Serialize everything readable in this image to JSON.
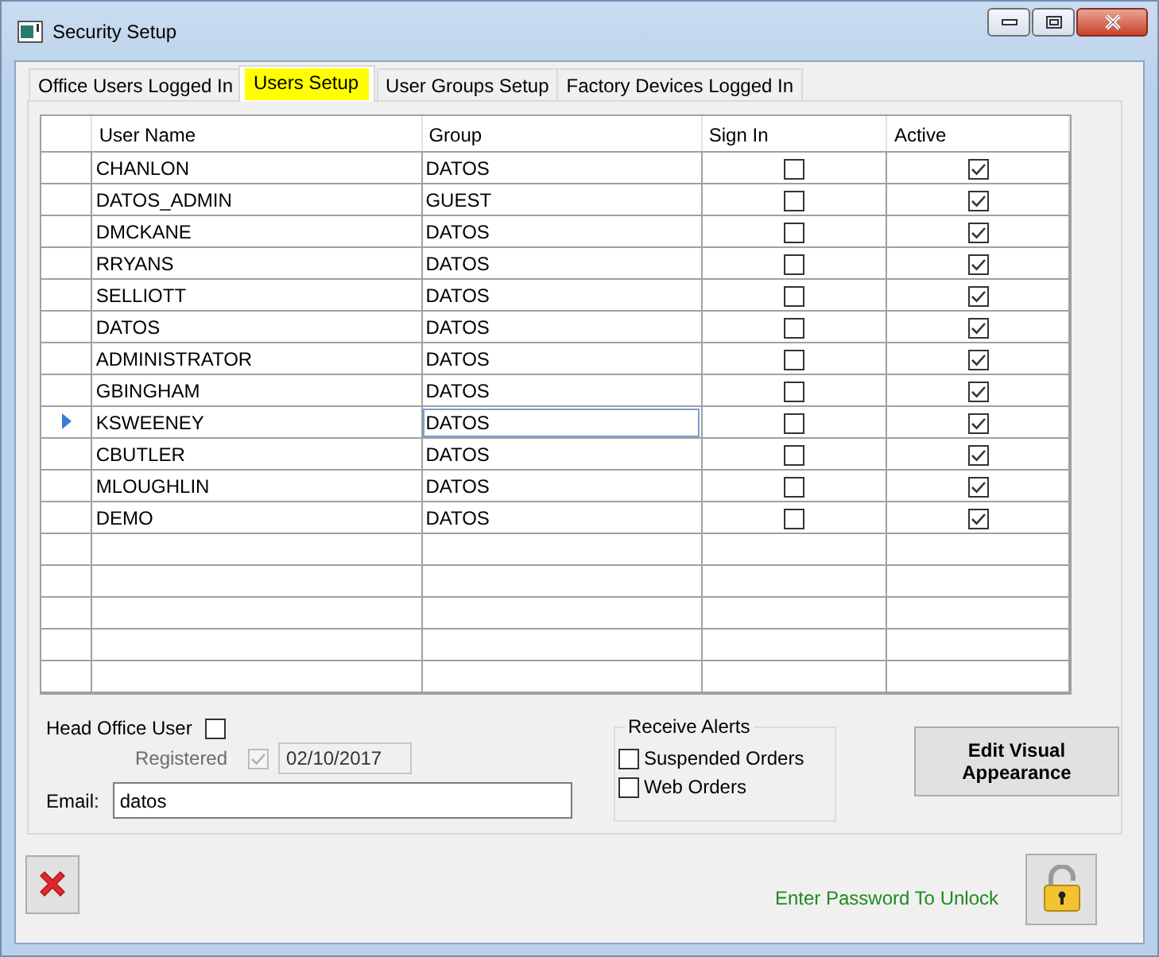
{
  "window": {
    "title": "Security Setup"
  },
  "tabs": [
    {
      "label": "Office Users Logged In",
      "selected": false
    },
    {
      "label": "Users Setup",
      "selected": true
    },
    {
      "label": "User Groups Setup",
      "selected": false
    },
    {
      "label": "Factory Devices Logged In",
      "selected": false
    }
  ],
  "table": {
    "columns": [
      "User Name",
      "Group",
      "Sign In",
      "Active"
    ],
    "rows": [
      {
        "user": "CHANLON",
        "group": "DATOS",
        "sign_in": false,
        "active": true,
        "selected": false
      },
      {
        "user": "DATOS_ADMIN",
        "group": "GUEST",
        "sign_in": false,
        "active": true,
        "selected": false
      },
      {
        "user": "DMCKANE",
        "group": "DATOS",
        "sign_in": false,
        "active": true,
        "selected": false
      },
      {
        "user": "RRYANS",
        "group": "DATOS",
        "sign_in": false,
        "active": true,
        "selected": false
      },
      {
        "user": "SELLIOTT",
        "group": "DATOS",
        "sign_in": false,
        "active": true,
        "selected": false
      },
      {
        "user": "DATOS",
        "group": "DATOS",
        "sign_in": false,
        "active": true,
        "selected": false
      },
      {
        "user": "ADMINISTRATOR",
        "group": "DATOS",
        "sign_in": false,
        "active": true,
        "selected": false
      },
      {
        "user": "GBINGHAM",
        "group": "DATOS",
        "sign_in": false,
        "active": true,
        "selected": false
      },
      {
        "user": "KSWEENEY",
        "group": "DATOS",
        "sign_in": false,
        "active": true,
        "selected": true
      },
      {
        "user": "CBUTLER",
        "group": "DATOS",
        "sign_in": false,
        "active": true,
        "selected": false
      },
      {
        "user": "MLOUGHLIN",
        "group": "DATOS",
        "sign_in": false,
        "active": true,
        "selected": false
      },
      {
        "user": "DEMO",
        "group": "DATOS",
        "sign_in": false,
        "active": true,
        "selected": false
      }
    ]
  },
  "head_office_user": {
    "label": "Head Office User",
    "checked": false
  },
  "registered": {
    "label": "Registered",
    "checked": true,
    "disabled": true,
    "date": "02/10/2017"
  },
  "email": {
    "label": "Email:",
    "value": "datos"
  },
  "receive_alerts": {
    "title": "Receive Alerts",
    "options": [
      {
        "label": "Suspended Orders",
        "checked": false
      },
      {
        "label": "Web Orders",
        "checked": false
      }
    ]
  },
  "edit_button": "Edit Visual Appearance",
  "lock_message": "Enter Password To Unlock"
}
